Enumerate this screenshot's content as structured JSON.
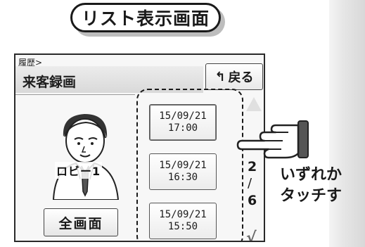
{
  "header": {
    "title": "リスト表示画面"
  },
  "screen": {
    "breadcrumb": "履歴>",
    "title": "来客録画",
    "back_button": {
      "label": "戻る",
      "icon": "return-arrow-icon"
    },
    "character_label": "ロビー1",
    "fullscreen_button": "全画面",
    "entries": [
      {
        "date": "15/09/21",
        "time": "17:00"
      },
      {
        "date": "15/09/21",
        "time": "16:30"
      },
      {
        "date": "15/09/21",
        "time": "15:50"
      }
    ],
    "pagination": {
      "current": "2",
      "total": "6"
    }
  },
  "callout": {
    "line1": "いずれか",
    "line2": "タッチす"
  }
}
